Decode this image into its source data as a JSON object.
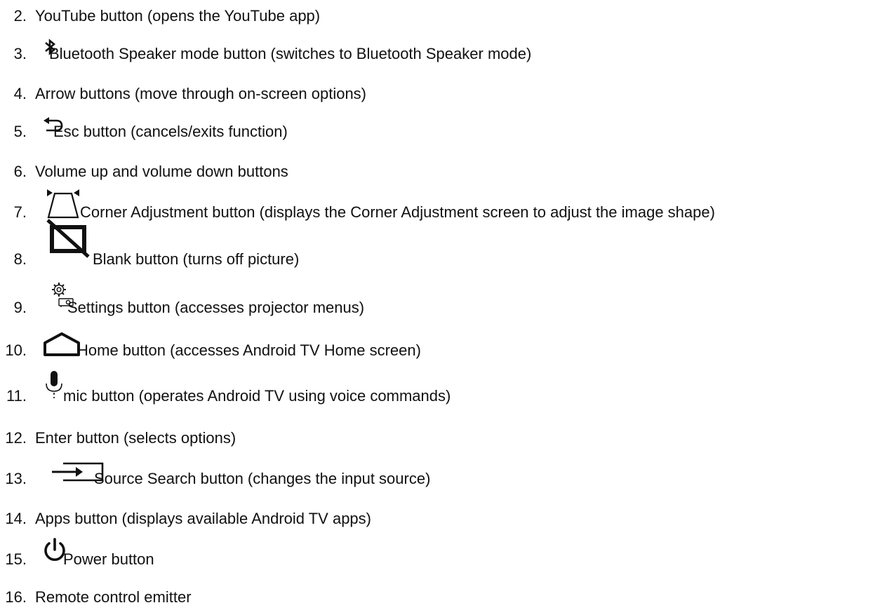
{
  "items": [
    {
      "number": "2.",
      "text": "YouTube button (opens the YouTube app)",
      "icon": ""
    },
    {
      "number": "3.",
      "text": "Bluetooth Speaker mode button (switches to Bluetooth Speaker mode)",
      "icon": "bluetooth-icon"
    },
    {
      "number": "4.",
      "text": "Arrow buttons (move through on-screen options)",
      "icon": ""
    },
    {
      "number": "5.",
      "text": "Esc button (cancels/exits function)",
      "icon": "back-arrow-icon"
    },
    {
      "number": "6.",
      "text": "Volume up and volume down buttons",
      "icon": ""
    },
    {
      "number": "7.",
      "text": "Corner Adjustment button (displays the Corner Adjustment screen to adjust the image shape)",
      "icon": "corner-adjustment-icon"
    },
    {
      "number": "8.",
      "text": "Blank button (turns off picture)",
      "icon": "blank-screen-icon"
    },
    {
      "number": "9.",
      "text": "Settings button (accesses projector menus)",
      "icon": "settings-projector-icon"
    },
    {
      "number": "10.",
      "text": "Home button (accesses Android TV Home screen)",
      "icon": "home-icon"
    },
    {
      "number": "11.",
      "text": "mic button (operates Android TV using voice commands)",
      "icon": "microphone-icon"
    },
    {
      "number": "12.",
      "text": "Enter button (selects options)",
      "icon": ""
    },
    {
      "number": "13.",
      "text": "Source Search button (changes the input source)",
      "icon": "source-input-icon"
    },
    {
      "number": "14.",
      "text": "Apps button (displays available Android TV apps)",
      "icon": ""
    },
    {
      "number": "15.",
      "text": "Power button",
      "icon": "power-icon"
    },
    {
      "number": "16.",
      "text": "Remote control emitter",
      "icon": ""
    }
  ]
}
